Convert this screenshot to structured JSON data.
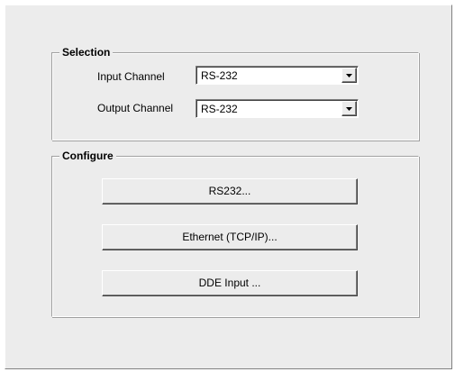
{
  "selection": {
    "title": "Selection",
    "input_label": "Input Channel",
    "input_value": "RS-232",
    "output_label": "Output Channel",
    "output_value": "RS-232"
  },
  "configure": {
    "title": "Configure",
    "buttons": [
      {
        "label": "RS232..."
      },
      {
        "label": "Ethernet (TCP/IP)..."
      },
      {
        "label": "DDE Input ..."
      }
    ]
  },
  "icons": [
    "chevron-down-icon"
  ]
}
